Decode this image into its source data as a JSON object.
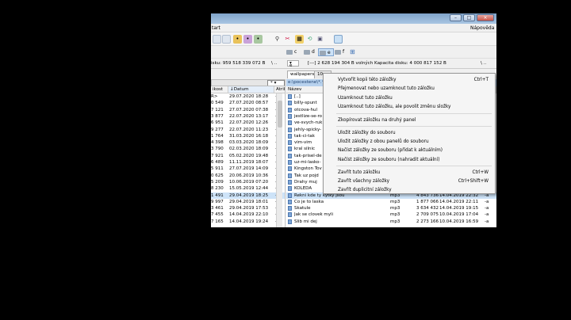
{
  "window": {
    "menu_right": "Nápověda",
    "menu_left": "tart"
  },
  "drives": {
    "items": [
      "c",
      "d",
      "e",
      "f"
    ],
    "active": "e"
  },
  "info": {
    "left_disk": "isku: 959 518 339 072 B",
    "left_nav": "\\   ..",
    "right_drive": "e",
    "right_disk": "[---]  2 628 194 304 B volných   Kapacita disku: 4 000 817 152 B",
    "right_nav": "\\   .."
  },
  "tabs": [
    "wallpapers",
    "10 ..."
  ],
  "left_pane": {
    "filter_star": "*",
    "headers": [
      "ikost",
      "Datum",
      "Atrib"
    ],
    "rows": [
      [
        "R>",
        "29.07.2020 18:28",
        "—"
      ],
      [
        "0 549",
        "27.07.2020 08:57",
        "-a"
      ],
      [
        "7 121",
        "27.07.2020 07:38",
        "-a"
      ],
      [
        "3 877",
        "22.07.2020 13:17",
        "-a"
      ],
      [
        "6 951",
        "22.07.2020 12:26",
        "-a"
      ],
      [
        "9 277",
        "22.07.2020 11:23",
        "-a"
      ],
      [
        "1 764",
        "31.03.2020 16:18",
        "-a"
      ],
      [
        "4 398",
        "03.03.2020 18:09",
        "-a"
      ],
      [
        "3 790",
        "02.03.2020 18:09",
        "-a"
      ],
      [
        "7 921",
        "05.02.2020 19:48",
        "-a"
      ],
      [
        "6 489",
        "11.11.2019 18:07",
        "-a"
      ],
      [
        "5 911",
        "27.07.2019 14:09",
        "-a"
      ],
      [
        "0 625",
        "20.06.2019 10:36",
        "-a"
      ],
      [
        "5 209",
        "10.06.2019 07:20",
        "-a"
      ],
      [
        "8 230",
        "15.05.2019 12:44",
        "-a"
      ],
      [
        "1 491",
        "29.04.2019 18:25",
        "-a"
      ],
      [
        "9 997",
        "29.04.2019 18:01",
        "-a"
      ],
      [
        "3 461",
        "29.04.2019 17:53",
        "-a"
      ],
      [
        "7 455",
        "14.04.2019 22:10",
        "-a"
      ],
      [
        "7 165",
        "14.04.2019 19:24",
        "-a"
      ]
    ]
  },
  "right_pane": {
    "path": "e:\\pocestene\\*.*",
    "headers": [
      "Název"
    ],
    "rows": [
      [
        "[..]",
        "",
        "",
        "",
        ""
      ],
      [
        "billy-spunt",
        "",
        "",
        "",
        ""
      ],
      [
        "otcova-hul",
        "",
        "",
        "",
        ""
      ],
      [
        "jestlize-se-ro",
        "",
        "",
        "",
        ""
      ],
      [
        "ve-svych-ruk",
        "",
        "",
        "",
        ""
      ],
      [
        "jehly-spicky-",
        "",
        "",
        "",
        ""
      ],
      [
        "tak-ci-tak",
        "",
        "",
        "",
        ""
      ],
      [
        "vim-vim",
        "",
        "",
        "",
        ""
      ],
      [
        "kral silnic",
        "",
        "",
        "",
        ""
      ],
      [
        "tak-prisel-de",
        "",
        "",
        "",
        ""
      ],
      [
        "uz-mi-lasko-",
        "",
        "",
        "",
        ""
      ],
      [
        "Kingston Tov",
        "",
        "",
        "",
        ""
      ],
      [
        "Tak uz pojd",
        "",
        "",
        "",
        ""
      ],
      [
        "Drahy muj",
        "",
        "",
        "",
        ""
      ],
      [
        "KOLEDA",
        "",
        "",
        "",
        ""
      ],
      [
        "Rekni kde ty kytky jsou",
        "mp3",
        "4 843 736",
        "14.04.2019 22:32",
        "-a"
      ],
      [
        "Co je to laska",
        "mp3",
        "1 877 066",
        "14.04.2019 22:11",
        "-a"
      ],
      [
        "Skatule",
        "mp3",
        "3 634 432",
        "14.04.2019 19:15",
        "-a"
      ],
      [
        "Jak se clovek myli",
        "mp3",
        "2 709 075",
        "10.04.2019 17:04",
        "-a"
      ],
      [
        "Slib mi dej",
        "mp3",
        "2 273 166",
        "10.04.2019 16:59",
        "-a"
      ]
    ]
  },
  "context_menu": {
    "items": [
      {
        "label": "Vytvořit kopii této záložky",
        "shortcut": "Ctrl+T"
      },
      {
        "label": "Přejmenovat nebo uzamknout tuto záložku",
        "shortcut": ""
      },
      {
        "label": "Uzamknout tuto záložku",
        "shortcut": ""
      },
      {
        "label": "Uzamknout tuto záložku, ale povolit změnu složky",
        "shortcut": ""
      },
      {
        "label": "Zkopírovat záložku na druhý panel",
        "shortcut": ""
      },
      {
        "label": "Uložit záložky do souboru",
        "shortcut": ""
      },
      {
        "label": "Uložit záložky z obou panelů do souboru",
        "shortcut": ""
      },
      {
        "label": "Načíst záložky ze souboru (přidat k aktuálním)",
        "shortcut": ""
      },
      {
        "label": "Načíst záložky ze souboru (nahradit aktuální)",
        "shortcut": ""
      },
      {
        "label": "Zavřít tuto záložku",
        "shortcut": "Ctrl+W"
      },
      {
        "label": "Zavřít všechny záložky",
        "shortcut": "Ctrl+Shift+W"
      },
      {
        "label": "Zavřít duplicitní záložky",
        "shortcut": ""
      }
    ]
  }
}
